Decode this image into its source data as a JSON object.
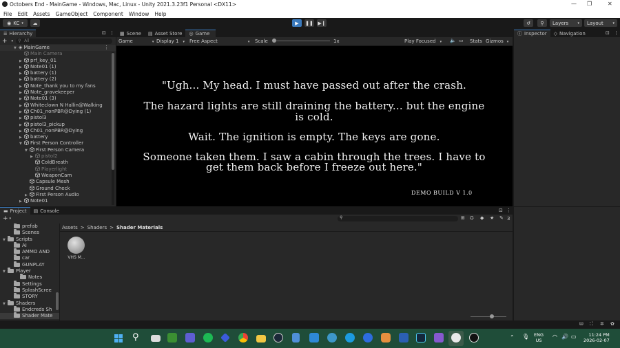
{
  "window": {
    "title": "Octobers End - MainGame - Windows, Mac, Linux - Unity 2021.3.23f1 Personal <DX11>",
    "min": "—",
    "max": "❐",
    "close": "✕"
  },
  "menu": [
    "File",
    "Edit",
    "Assets",
    "GameObject",
    "Component",
    "Window",
    "Help"
  ],
  "toolbar": {
    "account": "KC",
    "layers": "Layers",
    "layout": "Layout"
  },
  "hierarchy": {
    "tab": "Hierarchy",
    "search_placeholder": "All",
    "scene": "MainGame",
    "items": [
      {
        "label": "Main Camera",
        "dim": true,
        "indent": 1,
        "arrow": ""
      },
      {
        "label": "prf_key_01",
        "dim": false,
        "indent": 1,
        "arrow": "▶"
      },
      {
        "label": "Note01 (1)",
        "dim": false,
        "indent": 1,
        "arrow": "▶"
      },
      {
        "label": "battery (1)",
        "dim": false,
        "indent": 1,
        "arrow": "▶"
      },
      {
        "label": "battery (2)",
        "dim": false,
        "indent": 1,
        "arrow": "▶"
      },
      {
        "label": "Note_thank you to my fans",
        "dim": false,
        "indent": 1,
        "arrow": "▶"
      },
      {
        "label": "Note_gravekeeper",
        "dim": false,
        "indent": 1,
        "arrow": "▶"
      },
      {
        "label": "Note01 (3)",
        "dim": false,
        "indent": 1,
        "arrow": "▶"
      },
      {
        "label": "Whiteclown N Hallin@Walking",
        "dim": false,
        "indent": 1,
        "arrow": "▶"
      },
      {
        "label": "Ch01_nonPBR@Dying (1)",
        "dim": false,
        "indent": 1,
        "arrow": "▶"
      },
      {
        "label": "pistol3",
        "dim": false,
        "indent": 1,
        "arrow": "▶"
      },
      {
        "label": "pistol3_pickup",
        "dim": false,
        "indent": 1,
        "arrow": "▶"
      },
      {
        "label": "Ch01_nonPBR@Dying",
        "dim": false,
        "indent": 1,
        "arrow": "▶"
      },
      {
        "label": "battery",
        "dim": false,
        "indent": 1,
        "arrow": "▶"
      },
      {
        "label": "First Person Controller",
        "dim": false,
        "indent": 1,
        "arrow": "▼"
      },
      {
        "label": "First Person Camera",
        "dim": false,
        "indent": 2,
        "arrow": "▼"
      },
      {
        "label": "pistol2",
        "dim": true,
        "indent": 3,
        "arrow": "▶"
      },
      {
        "label": "ColdBreath",
        "dim": false,
        "indent": 3,
        "arrow": ""
      },
      {
        "label": "Playerlight",
        "dim": true,
        "indent": 3,
        "arrow": ""
      },
      {
        "label": "WeaponCam",
        "dim": false,
        "indent": 3,
        "arrow": ""
      },
      {
        "label": "Capsule Mesh",
        "dim": false,
        "indent": 2,
        "arrow": ""
      },
      {
        "label": "Ground Check",
        "dim": false,
        "indent": 2,
        "arrow": ""
      },
      {
        "label": "First Person Audio",
        "dim": false,
        "indent": 2,
        "arrow": "▶"
      },
      {
        "label": "Note01",
        "dim": false,
        "indent": 1,
        "arrow": "▶"
      }
    ]
  },
  "center_tabs": [
    "Scene",
    "Asset Store",
    "Game"
  ],
  "game_toolbar": {
    "mode": "Game",
    "display": "Display 1",
    "aspect": "Free Aspect",
    "scale_label": "Scale",
    "scale_value": "1x",
    "play_focused": "Play Focused",
    "stats": "Stats",
    "gizmos": "Gizmos"
  },
  "game_text": {
    "line1": "\"Ugh... My head. I must have passed out after the crash.",
    "line2": "The hazard lights are still draining the battery... but the engine",
    "line3": "is cold.",
    "line4": "Wait. The ignition is empty. The keys are gone.",
    "line5": "Someone taken them. I saw a cabin through the trees. I have to",
    "line6": "get them back before I freeze out here.\"",
    "build": "DEMO BUILD V 1.0"
  },
  "right_tabs": [
    "Inspector",
    "Navigation"
  ],
  "bottom_tabs": [
    "Project",
    "Console"
  ],
  "project": {
    "breadcrumb": [
      "Assets",
      "Shaders",
      "Shader Materials"
    ],
    "folders": [
      {
        "label": "prefab",
        "indent": 1
      },
      {
        "label": "Scenes",
        "indent": 1
      },
      {
        "label": "Scripts",
        "indent": 0
      },
      {
        "label": "AI",
        "indent": 1
      },
      {
        "label": "AMMO AND",
        "indent": 1
      },
      {
        "label": "car",
        "indent": 1
      },
      {
        "label": "GUNPLAY",
        "indent": 1
      },
      {
        "label": "Player",
        "indent": 0
      },
      {
        "label": "Notes",
        "indent": 2
      },
      {
        "label": "Settings",
        "indent": 1
      },
      {
        "label": "SplashScree",
        "indent": 1
      },
      {
        "label": "STORY",
        "indent": 1
      },
      {
        "label": "Shaders",
        "indent": 0
      },
      {
        "label": "Endcreds Sh",
        "indent": 1
      },
      {
        "label": "Shader Mate",
        "indent": 1
      }
    ],
    "asset_label": "VHS M...",
    "count": "3"
  },
  "tray": {
    "lang1": "ENG",
    "lang2": "US",
    "time": "11:24 PM",
    "date": "2026-02-07"
  },
  "colors": {
    "accent": "#3a79bb",
    "play_active": "#3a79bb",
    "taskbar": "#1f4d39",
    "editor_bg": "#282828"
  }
}
